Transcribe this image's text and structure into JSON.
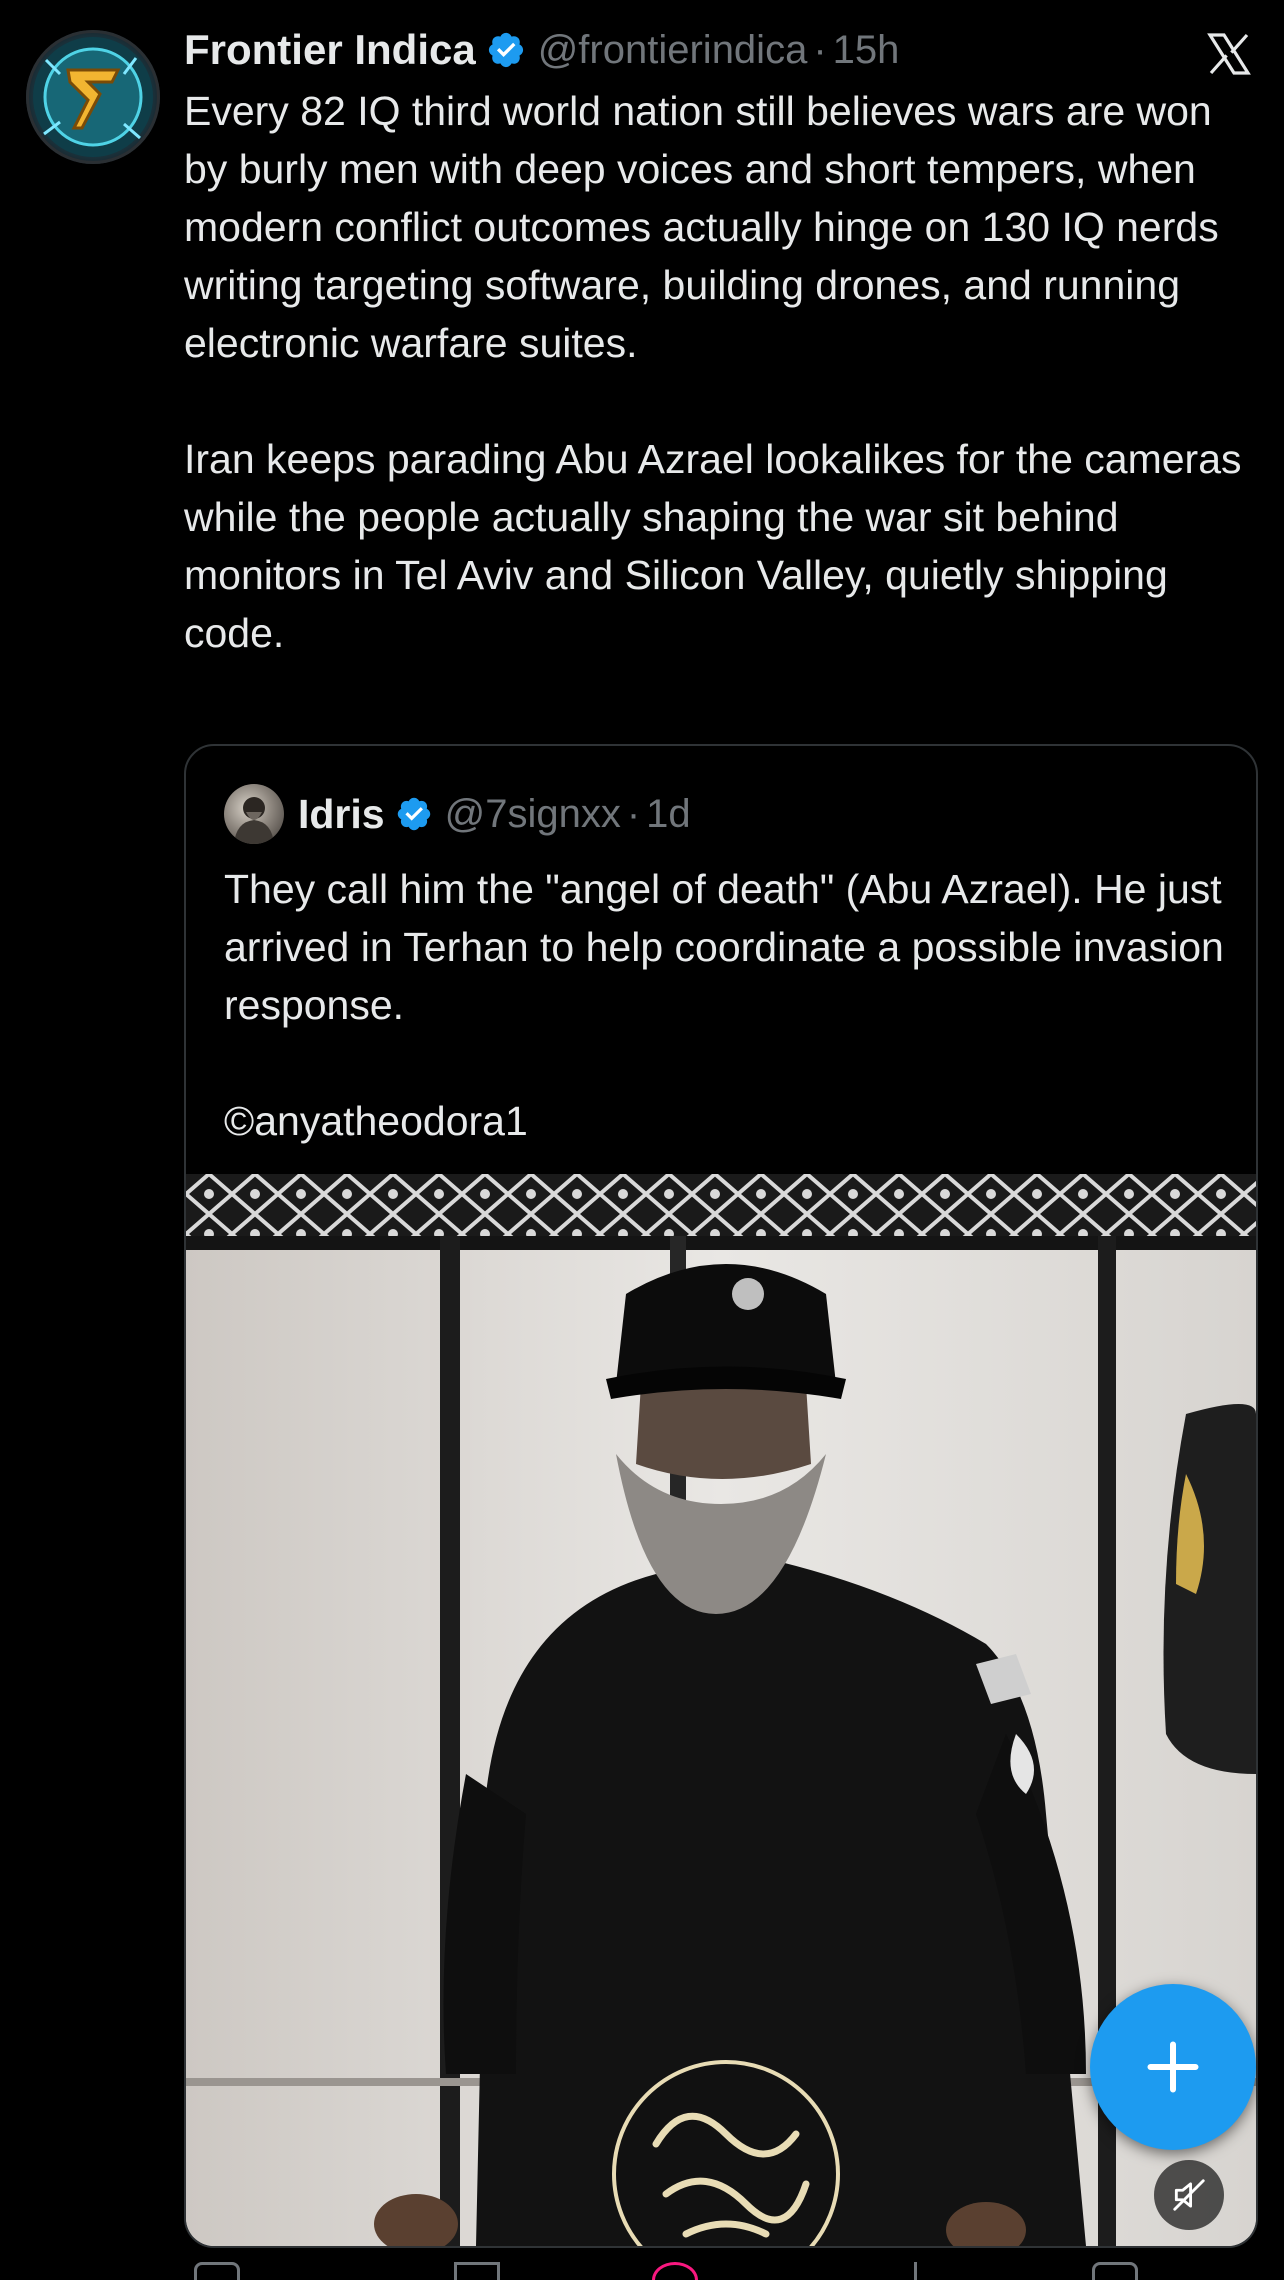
{
  "tweet": {
    "author_name": "Frontier Indica",
    "author_handle": "@frontierindica",
    "separator": "·",
    "time": "15h",
    "text": "Every 82 IQ third world nation still believes wars are won by burly men with deep voices and short tempers, when modern conflict outcomes actually hinge on 130 IQ nerds writing targeting software, building drones, and running electronic warfare suites.\n\nIran keeps parading Abu Azrael lookalikes for the cameras while the people actually shaping the war sit behind monitors in Tel Aviv and Silicon Valley, quietly shipping code."
  },
  "quote": {
    "author_name": "Idris",
    "author_handle": "@7signxx",
    "separator": "·",
    "time": "1d",
    "text": "They call him the \"angel of death\" (Abu Azrael). He just arrived in Terhan to help coordinate a possible invasion response.\n\n©anyatheodora1"
  },
  "icons": {
    "verified": "verified-badge-icon",
    "x_logo": "x-logo-icon",
    "compose": "plus-icon",
    "mute": "muted-speaker-icon"
  },
  "colors": {
    "background": "#000000",
    "text": "#e7e9ea",
    "secondary_text": "#71767b",
    "accent": "#1d9bf0",
    "border": "#2f3336"
  }
}
